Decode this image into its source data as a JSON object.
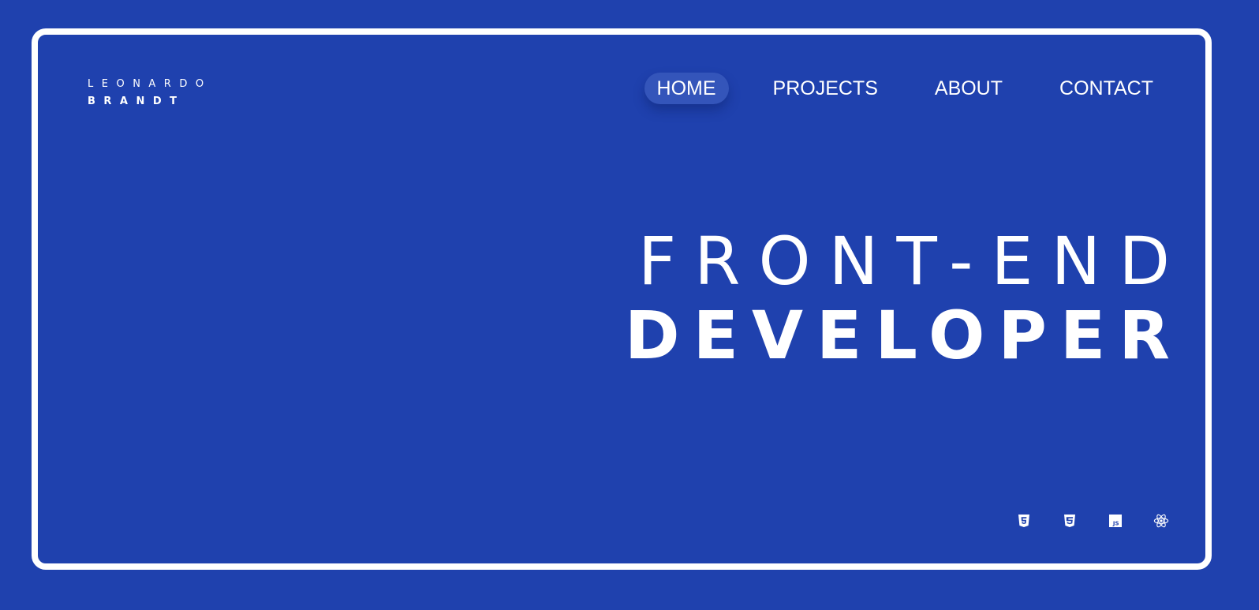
{
  "brand": {
    "first_name": "LEONARDO",
    "last_name": "BRANDT"
  },
  "nav": {
    "items": [
      {
        "label": "HOME",
        "active": true
      },
      {
        "label": "PROJECTS",
        "active": false
      },
      {
        "label": "ABOUT",
        "active": false
      },
      {
        "label": "CONTACT",
        "active": false
      }
    ]
  },
  "hero": {
    "line1": "FRONT-END",
    "line2": "DEVELOPER"
  },
  "tech_icons": [
    "html5-icon",
    "css3-icon",
    "javascript-icon",
    "react-icon"
  ],
  "colors": {
    "background": "#1f41ae",
    "frame": "#ffffff",
    "active_pill": "#3455ba"
  }
}
